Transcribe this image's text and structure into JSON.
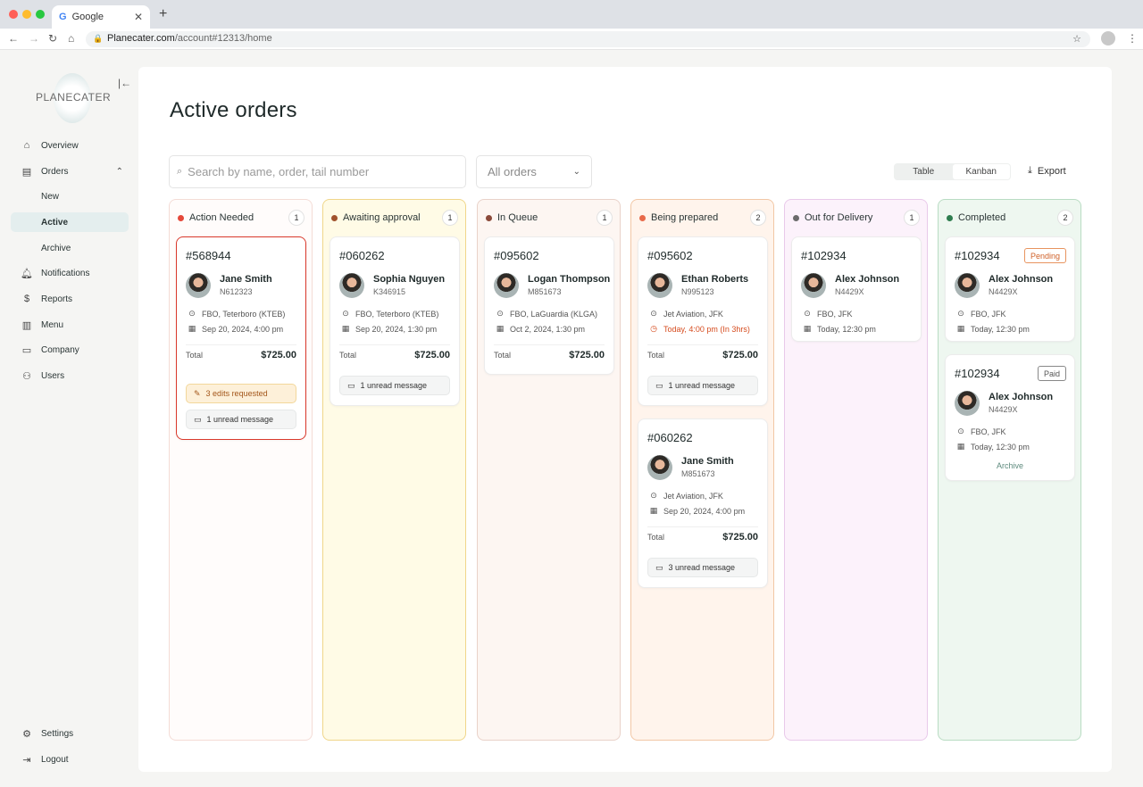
{
  "browser": {
    "tab_title": "Google",
    "url_host": "Planecater.com",
    "url_path": "/account#12313/home"
  },
  "brand": {
    "name": "PLANECATER"
  },
  "sidebar": {
    "items": [
      {
        "label": "Overview"
      },
      {
        "label": "Orders"
      },
      {
        "label": "New"
      },
      {
        "label": "Active"
      },
      {
        "label": "Archive"
      },
      {
        "label": "Notifications"
      },
      {
        "label": "Reports"
      },
      {
        "label": "Menu"
      },
      {
        "label": "Company"
      },
      {
        "label": "Users"
      },
      {
        "label": "Settings"
      },
      {
        "label": "Logout"
      }
    ]
  },
  "page": {
    "title": "Active orders",
    "search_placeholder": "Search by name, order, tail number",
    "filter_value": "All orders",
    "view_table": "Table",
    "view_kanban": "Kanban",
    "export_label": "Export"
  },
  "columns": [
    {
      "title": "Action Needed",
      "count": "1",
      "dot": "#e5483a",
      "bg": "#fffcfb",
      "border": "#f4dcd6",
      "cards": [
        {
          "id": "#568944",
          "name": "Jane Smith",
          "tail": "N612323",
          "location": "FBO, Teterboro (KTEB)",
          "date": "Sep 20, 2024, 4:00 pm",
          "total_label": "Total",
          "total": "$725.00",
          "edits": "3 edits requested",
          "messages": "1 unread message"
        }
      ]
    },
    {
      "title": "Awaiting approval",
      "count": "1",
      "dot": "#a0522d",
      "bg": "#fffbe6",
      "border": "#f0d68a",
      "cards": [
        {
          "id": "#060262",
          "name": "Sophia Nguyen",
          "tail": "K346915",
          "location": "FBO, Teterboro (KTEB)",
          "date": "Sep 20, 2024, 1:30 pm",
          "total_label": "Total",
          "total": "$725.00",
          "messages": "1 unread message"
        }
      ]
    },
    {
      "title": "In Queue",
      "count": "1",
      "dot": "#8b4a3a",
      "bg": "#fdf6f2",
      "border": "#e9d2c9",
      "cards": [
        {
          "id": "#095602",
          "name": "Logan Thompson",
          "tail": "M851673",
          "location": "FBO, LaGuardia (KLGA)",
          "date": "Oct 2, 2024, 1:30 pm",
          "total_label": "Total",
          "total": "$725.00"
        }
      ]
    },
    {
      "title": "Being prepared",
      "count": "2",
      "dot": "#e86a4a",
      "bg": "#fff4ec",
      "border": "#f2c7a6",
      "cards": [
        {
          "id": "#095602",
          "name": "Ethan Roberts",
          "tail": "N995123",
          "location": "Jet Aviation, JFK",
          "date": "Today, 4:00 pm (In 3hrs)",
          "total_label": "Total",
          "total": "$725.00",
          "messages": "1 unread message"
        },
        {
          "id": "#060262",
          "name": "Jane Smith",
          "tail": "M851673",
          "location": "Jet Aviation, JFK",
          "date": "Sep 20, 2024, 4:00 pm",
          "total_label": "Total",
          "total": "$725.00",
          "messages": "3 unread message"
        }
      ]
    },
    {
      "title": "Out for Delivery",
      "count": "1",
      "dot": "#6b6b6b",
      "bg": "#fcf2fb",
      "border": "#e9c9ea",
      "cards": [
        {
          "id": "#102934",
          "name": "Alex Johnson",
          "tail": "N4429X",
          "location": "FBO, JFK",
          "date": "Today, 12:30 pm"
        }
      ]
    },
    {
      "title": "Completed",
      "count": "2",
      "dot": "#2e7d4f",
      "bg": "#eef7f0",
      "border": "#b9dcc3",
      "cards": [
        {
          "id": "#102934",
          "name": "Alex Johnson",
          "tail": "N4429X",
          "location": "FBO, JFK",
          "date": "Today, 12:30 pm",
          "badge": "Pending"
        },
        {
          "id": "#102934",
          "name": "Alex Johnson",
          "tail": "N4429X",
          "location": "FBO, JFK",
          "date": "Today, 12:30 pm",
          "badge": "Paid",
          "archive": "Archive"
        }
      ]
    }
  ]
}
